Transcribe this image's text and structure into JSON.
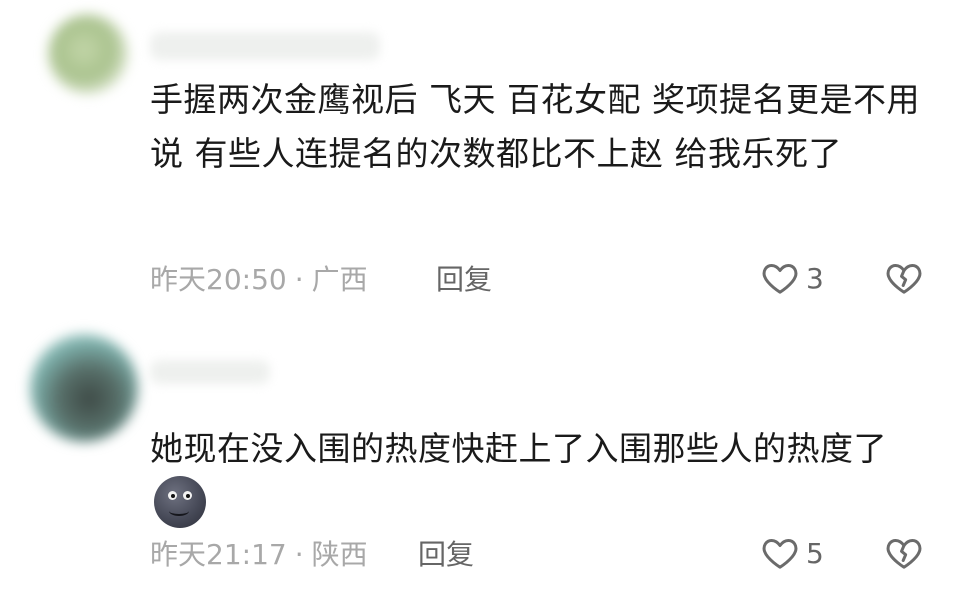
{
  "comments": [
    {
      "text": "手握两次金鹰视后 飞天 百花女配 奖项提名更是不用说  有些人连提名的次数都比不上赵 给我乐死了",
      "time": "昨天20:50",
      "location": "广西",
      "reply_label": "回复",
      "likes": "3",
      "icons": {
        "like": "heart-outline-icon",
        "dislike": "broken-heart-icon"
      }
    },
    {
      "text": "她现在没入围的热度快赶上了入围那些人的热度了",
      "emoji": "dark-moon-face-emoji",
      "time": "昨天21:17",
      "location": "陕西",
      "reply_label": "回复",
      "likes": "5",
      "icons": {
        "like": "heart-outline-icon",
        "dislike": "broken-heart-icon"
      }
    }
  ]
}
